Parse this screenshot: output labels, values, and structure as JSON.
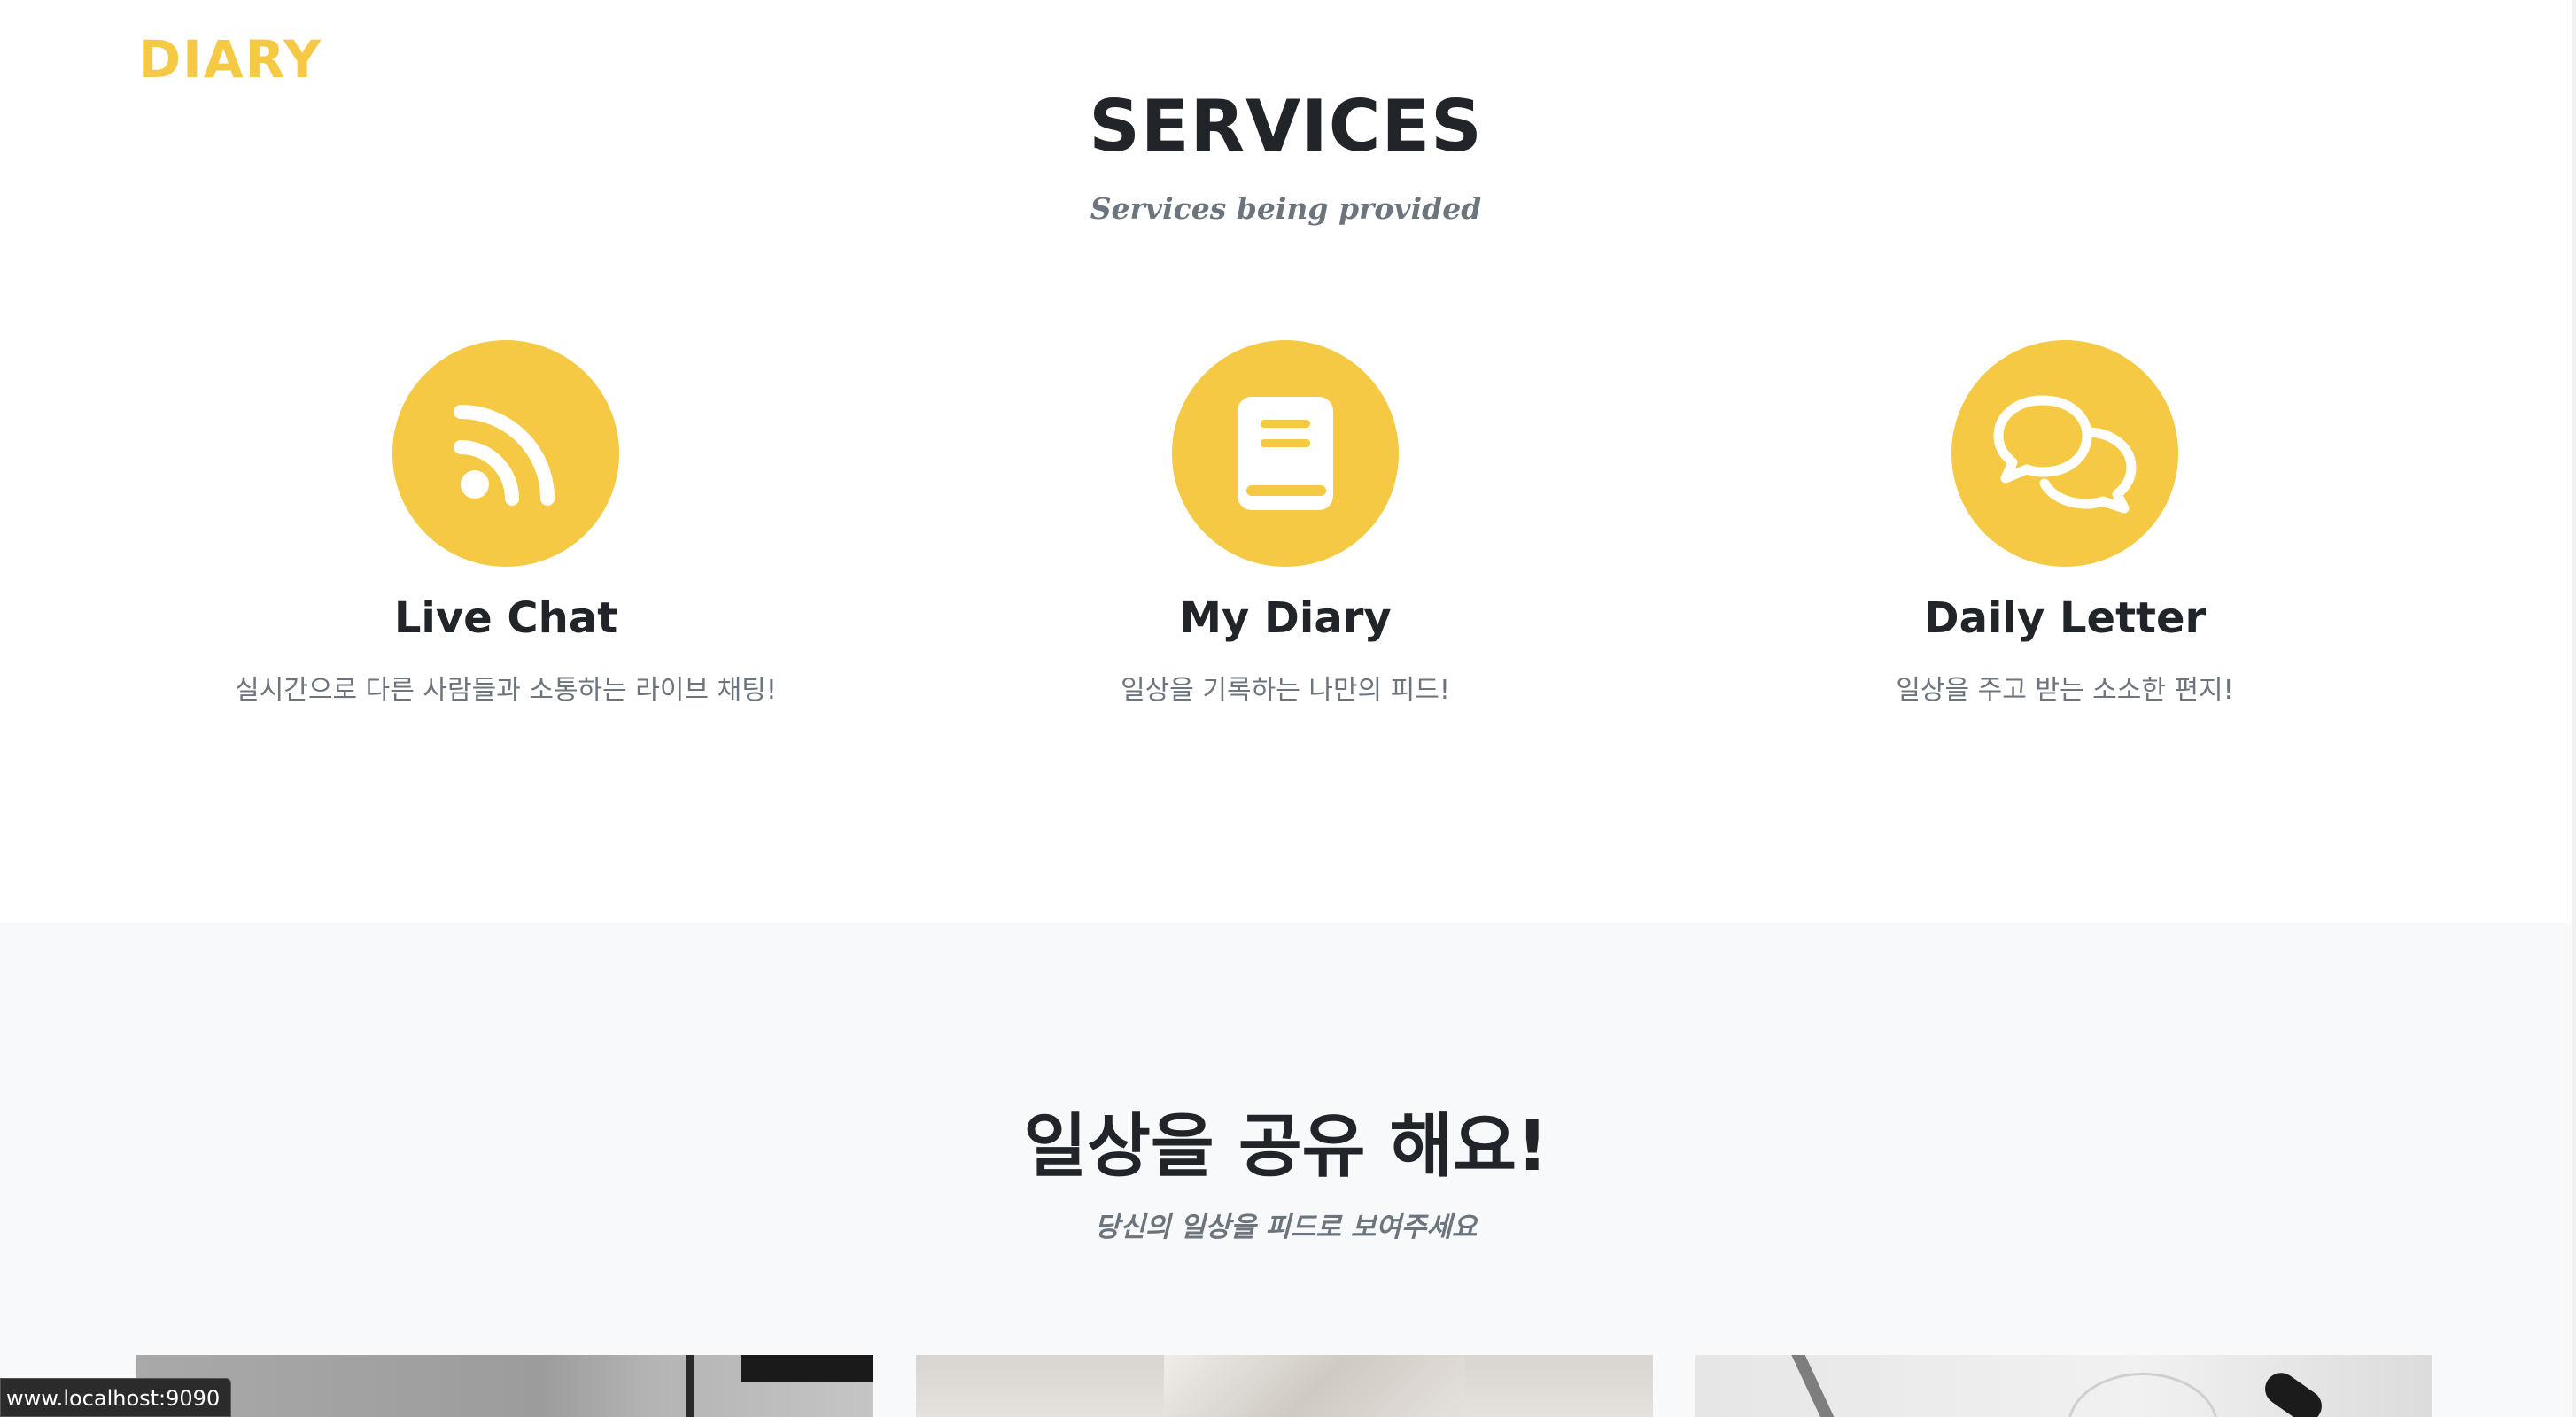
{
  "navbar": {
    "brand": "DIARY"
  },
  "services": {
    "title": "SERVICES",
    "subtitle": "Services being provided",
    "items": [
      {
        "icon": "rss-icon",
        "title": "Live Chat",
        "desc": "실시간으로 다른 사람들과 소통하는 라이브 채팅!"
      },
      {
        "icon": "book-icon",
        "title": "My Diary",
        "desc": "일상을 기록하는 나만의 피드!"
      },
      {
        "icon": "chat-bubbles-icon",
        "title": "Daily Letter",
        "desc": "일상을 주고 받는 소소한 편지!"
      }
    ]
  },
  "share": {
    "title": "일상을 공유 해요!",
    "subtitle": "당신의 일상을 피드로 보여주세요"
  },
  "status_bar": {
    "url": "www.localhost:9090"
  },
  "colors": {
    "accent": "#f5c944",
    "heading": "#212529",
    "muted": "#6c757d",
    "section_bg": "#f8f9fa"
  }
}
